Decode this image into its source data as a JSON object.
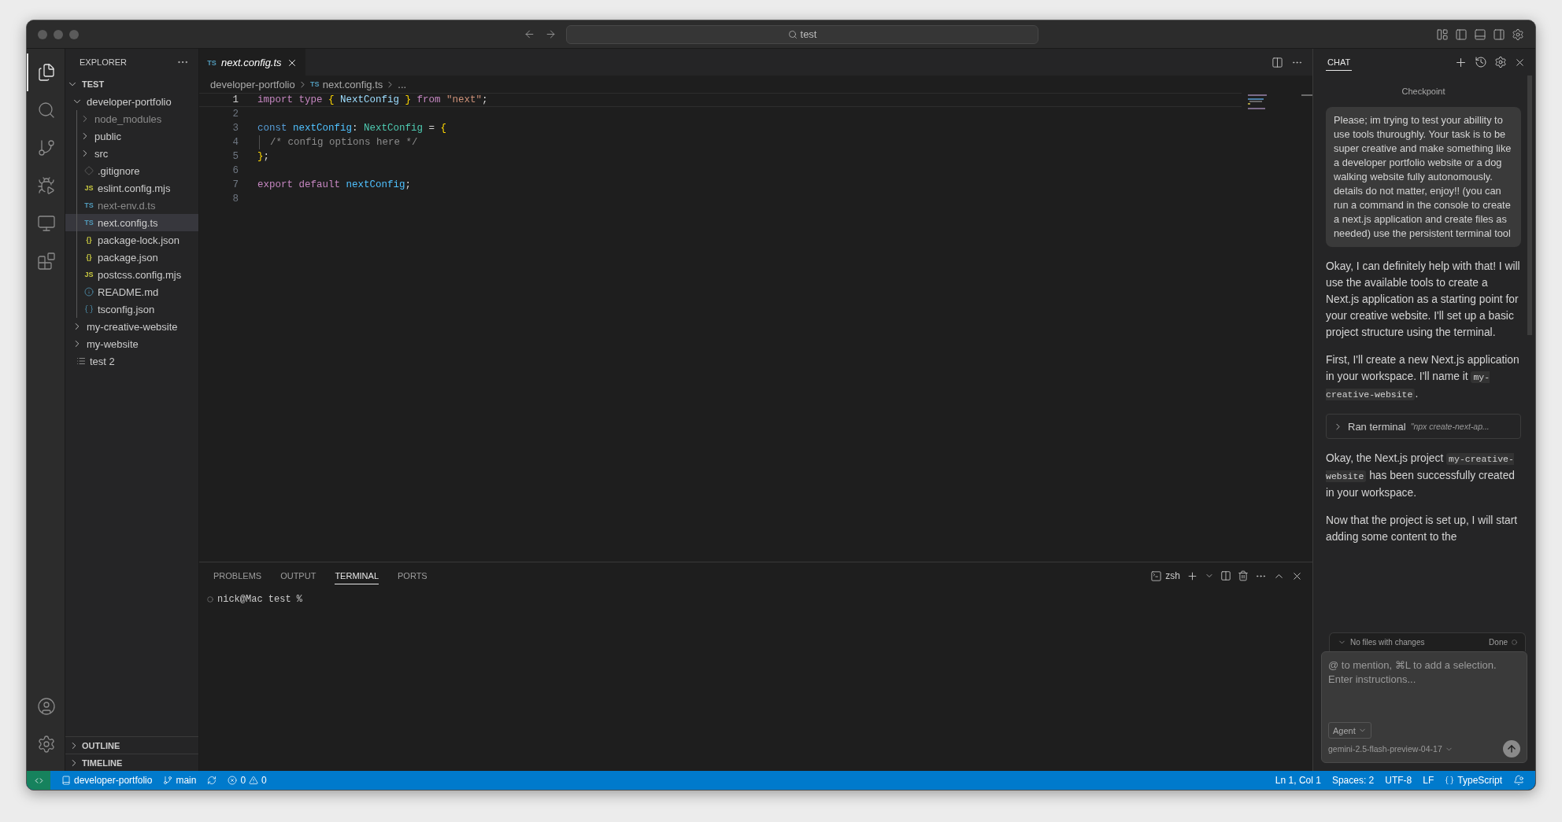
{
  "window": {
    "title": "test"
  },
  "activity_bar": {
    "top": [
      {
        "kind": "files",
        "selected": true
      },
      {
        "kind": "search",
        "selected": false
      },
      {
        "kind": "source-control",
        "selected": false
      },
      {
        "kind": "run",
        "selected": false
      },
      {
        "kind": "remote",
        "selected": false
      },
      {
        "kind": "extensions",
        "selected": false
      }
    ],
    "bottom": [
      {
        "kind": "account"
      },
      {
        "kind": "settings"
      }
    ]
  },
  "sidebar": {
    "title": "EXPLORER",
    "tree": {
      "label": "TEST",
      "expanded": true,
      "children": [
        {
          "label": "developer-portfolio",
          "kind": "folder",
          "expanded": true,
          "selected": false,
          "ignored": false,
          "children": [
            {
              "label": "node_modules",
              "kind": "folder",
              "expanded": false,
              "selected": false,
              "ignored": true
            },
            {
              "label": "public",
              "kind": "folder",
              "expanded": false,
              "selected": false,
              "ignored": false
            },
            {
              "label": "src",
              "kind": "folder",
              "expanded": false,
              "selected": false,
              "ignored": false
            },
            {
              "label": ".gitignore",
              "kind": "git",
              "selected": false,
              "ignored": false
            },
            {
              "label": "eslint.config.mjs",
              "kind": "js",
              "badge": "JS",
              "selected": false,
              "ignored": false
            },
            {
              "label": "next-env.d.ts",
              "kind": "ts",
              "badge": "TS",
              "selected": false,
              "ignored": true
            },
            {
              "label": "next.config.ts",
              "kind": "ts",
              "badge": "TS",
              "selected": true,
              "ignored": false
            },
            {
              "label": "package-lock.json",
              "kind": "json",
              "badge": "{}",
              "selected": false,
              "ignored": false
            },
            {
              "label": "package.json",
              "kind": "json",
              "badge": "{}",
              "selected": false,
              "ignored": false
            },
            {
              "label": "postcss.config.mjs",
              "kind": "js",
              "badge": "JS",
              "selected": false,
              "ignored": false
            },
            {
              "label": "README.md",
              "kind": "info",
              "selected": false,
              "ignored": false
            },
            {
              "label": "tsconfig.json",
              "kind": "tsconfig",
              "selected": false,
              "ignored": false
            }
          ]
        },
        {
          "label": "my-creative-website",
          "kind": "folder",
          "expanded": false,
          "selected": false,
          "ignored": false
        },
        {
          "label": "my-website",
          "kind": "folder",
          "expanded": false,
          "selected": false,
          "ignored": false
        },
        {
          "label": "test 2",
          "kind": "text",
          "selected": false,
          "ignored": false
        }
      ]
    },
    "sections": [
      {
        "label": "OUTLINE",
        "expanded": false
      },
      {
        "label": "TIMELINE",
        "expanded": false
      }
    ]
  },
  "editor": {
    "tabs": [
      {
        "label": "next.config.ts",
        "badge": "TS",
        "selected": true,
        "preview": true
      }
    ],
    "breadcrumbs": [
      {
        "label": "developer-portfolio"
      },
      {
        "label": "next.config.ts",
        "badge": "TS"
      },
      {
        "label": "..."
      }
    ],
    "lines": [
      {
        "number": "1",
        "current": true,
        "tokens": [
          {
            "text": "import ",
            "kind": "keyword"
          },
          {
            "text": "type ",
            "kind": "keyword"
          },
          {
            "text": "{ ",
            "kind": "bracket"
          },
          {
            "text": "NextConfig ",
            "kind": "variable"
          },
          {
            "text": "} ",
            "kind": "bracket"
          },
          {
            "text": "from ",
            "kind": "keyword"
          },
          {
            "text": "\"next\"",
            "kind": "string"
          },
          {
            "text": ";",
            "kind": "plain"
          }
        ]
      },
      {
        "number": "2",
        "current": false
      },
      {
        "number": "3",
        "current": false,
        "tokens": [
          {
            "text": "const ",
            "kind": "storage"
          },
          {
            "text": "nextConfig",
            "kind": "constant"
          },
          {
            "text": ": ",
            "kind": "plain"
          },
          {
            "text": "NextConfig",
            "kind": "type"
          },
          {
            "text": " = ",
            "kind": "plain"
          },
          {
            "text": "{",
            "kind": "bracket"
          }
        ]
      },
      {
        "number": "4",
        "current": false,
        "guide": true,
        "tokens": [
          {
            "text": "/* config options here */",
            "kind": "comment"
          }
        ]
      },
      {
        "number": "5",
        "current": false,
        "tokens": [
          {
            "text": "}",
            "kind": "bracket"
          },
          {
            "text": ";",
            "kind": "plain"
          }
        ]
      },
      {
        "number": "6",
        "current": false
      },
      {
        "number": "7",
        "current": false,
        "tokens": [
          {
            "text": "export ",
            "kind": "keyword"
          },
          {
            "text": "default ",
            "kind": "keyword"
          },
          {
            "text": "nextConfig",
            "kind": "constant"
          },
          {
            "text": ";",
            "kind": "plain"
          }
        ]
      },
      {
        "number": "8",
        "current": false
      }
    ]
  },
  "panel": {
    "tabs": [
      {
        "label": "PROBLEMS",
        "selected": false
      },
      {
        "label": "OUTPUT",
        "selected": false
      },
      {
        "label": "TERMINAL",
        "selected": true
      },
      {
        "label": "PORTS",
        "selected": false
      }
    ],
    "shell": "zsh",
    "terminal": [
      {
        "prompt": "nick@Mac test %"
      }
    ]
  },
  "chat": {
    "title": "CHAT",
    "checkpoint": "Checkpoint",
    "messages": [
      {
        "kind": "user",
        "text": "Please; im trying to test your abillity to use tools thuroughly. Your task is to be super creative and make something like a developer portfolio website or a dog walking website fully autonomously. details do not matter, enjoy!! (you can run a command in the console to create a next.js application and create files as needed) use the persistent terminal tool"
      },
      {
        "kind": "paragraph",
        "parts": [
          {
            "text": "Okay, I can definitely help with that! I will use the available tools to create a Next.js application as a starting point for your creative website. I'll set up a basic project structure using the terminal.",
            "code": false
          }
        ]
      },
      {
        "kind": "paragraph",
        "parts": [
          {
            "text": "First, I'll create a new Next.js application in your workspace. I'll name it ",
            "code": false
          },
          {
            "text": "my-creative-website",
            "code": true
          },
          {
            "text": ".",
            "code": false
          }
        ]
      },
      {
        "kind": "tool",
        "label": "Ran terminal",
        "detail": "\"npx create-next-ap...",
        "expanded": false
      },
      {
        "kind": "paragraph",
        "parts": [
          {
            "text": "Okay, the Next.js project ",
            "code": false
          },
          {
            "text": "my-creative-website",
            "code": true
          },
          {
            "text": " has been successfully created in your workspace.",
            "code": false
          }
        ]
      },
      {
        "kind": "paragraph",
        "parts": [
          {
            "text": "Now that the project is set up, I will start adding some content to the",
            "code": false
          }
        ]
      }
    ],
    "changes": {
      "label": "No files with changes",
      "expanded": false,
      "status": "Done"
    },
    "composer": {
      "placeholder": "@ to mention, ⌘L to add a selection.\nEnter instructions...",
      "mode": "Agent",
      "model": "gemini-2.5-flash-preview-04-17"
    }
  },
  "status_bar": {
    "left": [
      {
        "kind": "remote"
      },
      {
        "kind": "repo",
        "text": "developer-portfolio"
      },
      {
        "kind": "branch",
        "text": "main"
      },
      {
        "kind": "sync"
      },
      {
        "kind": "problems",
        "errors": "0",
        "warnings": "0"
      }
    ],
    "right": [
      {
        "kind": "text",
        "text": "Ln 1, Col 1"
      },
      {
        "kind": "text",
        "text": "Spaces: 2"
      },
      {
        "kind": "text",
        "text": "UTF-8"
      },
      {
        "kind": "text",
        "text": "LF"
      },
      {
        "kind": "language",
        "text": "TypeScript"
      },
      {
        "kind": "bell"
      }
    ]
  }
}
